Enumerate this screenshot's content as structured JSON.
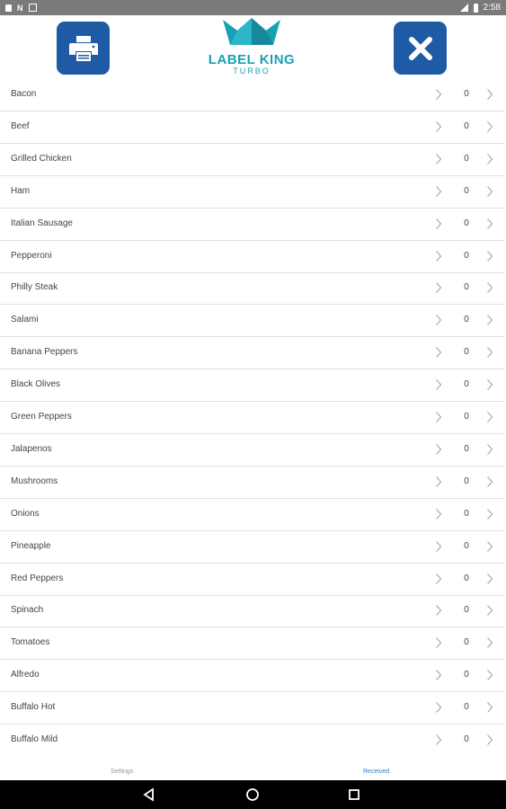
{
  "status_bar": {
    "time": "2:58",
    "left_icons": [
      "lock-icon",
      "n-icon",
      "app-icon"
    ],
    "right_icons": [
      "signal-icon",
      "battery-icon"
    ]
  },
  "header": {
    "print_button_icon": "printer-icon",
    "close_button_icon": "close-icon",
    "logo": {
      "title": "LABEL KING",
      "subtitle": "TURBO"
    }
  },
  "items": [
    {
      "label": "Bacon",
      "count": "0"
    },
    {
      "label": "Beef",
      "count": "0"
    },
    {
      "label": "Grilled Chicken",
      "count": "0"
    },
    {
      "label": "Ham",
      "count": "0"
    },
    {
      "label": "Italian Sausage",
      "count": "0"
    },
    {
      "label": "Pepperoni",
      "count": "0"
    },
    {
      "label": "Philly Steak",
      "count": "0"
    },
    {
      "label": "Salami",
      "count": "0"
    },
    {
      "label": "Banana Peppers",
      "count": "0"
    },
    {
      "label": "Black Olives",
      "count": "0"
    },
    {
      "label": "Green Peppers",
      "count": "0"
    },
    {
      "label": "Jalapenos",
      "count": "0"
    },
    {
      "label": "Mushrooms",
      "count": "0"
    },
    {
      "label": "Onions",
      "count": "0"
    },
    {
      "label": "Pineapple",
      "count": "0"
    },
    {
      "label": "Red Peppers",
      "count": "0"
    },
    {
      "label": "Spinach",
      "count": "0"
    },
    {
      "label": "Tomatoes",
      "count": "0"
    },
    {
      "label": "Alfredo",
      "count": "0"
    },
    {
      "label": "Buffalo Hot",
      "count": "0"
    },
    {
      "label": "Buffalo Mild",
      "count": "0"
    }
  ],
  "tabs": [
    {
      "label": "Settings",
      "active": false
    },
    {
      "label": "Received",
      "active": true
    }
  ],
  "colors": {
    "button_blue": "#1f5aa5",
    "logo_teal": "#1aa0b4",
    "active_tab": "#2d7fd8"
  }
}
